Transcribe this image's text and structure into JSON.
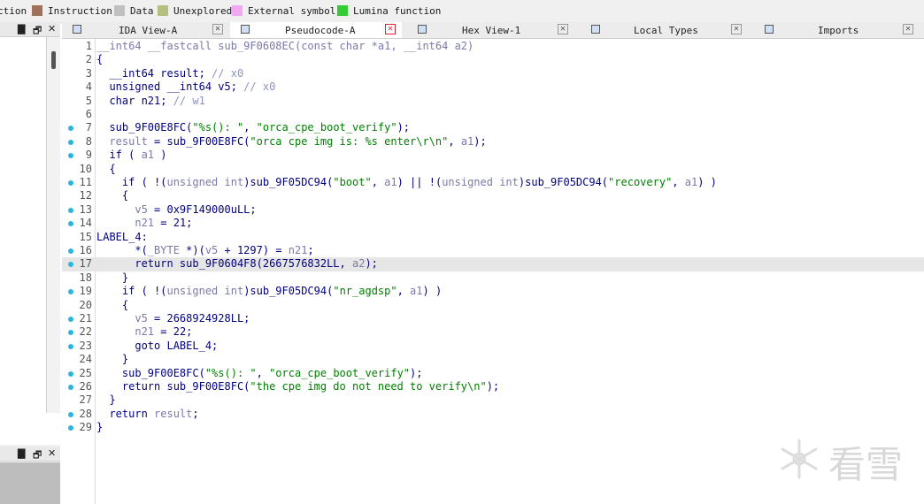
{
  "legend": [
    {
      "label": "ction",
      "color": null
    },
    {
      "label": "Instruction",
      "color": "#a0705a"
    },
    {
      "label": "Data",
      "color": "#c0c0c0"
    },
    {
      "label": "Unexplored",
      "color": "#b4c07e"
    },
    {
      "label": "External symbol",
      "color": "#f4a8f4"
    },
    {
      "label": "Lumina function",
      "color": "#33cc33"
    }
  ],
  "pane_controls": {
    "menu": "▇",
    "float": "🗗",
    "close": "✕"
  },
  "tabs": [
    {
      "label": "IDA View-A",
      "active": false
    },
    {
      "label": "Pseudocode-A",
      "active": true
    },
    {
      "label": "Hex View-1",
      "active": false
    },
    {
      "label": "Local Types",
      "active": false
    },
    {
      "label": "Imports",
      "active": false
    }
  ],
  "code_lines": [
    {
      "n": "1",
      "dot": false,
      "html": "<span class=\"gr\">__int64 __fastcall sub_9F0608EC(const char *a1, __int64 a2)</span>"
    },
    {
      "n": "2",
      "dot": false,
      "html": "{"
    },
    {
      "n": "3",
      "dot": false,
      "html": "  __int64 result; <span class=\"cm\">// x0</span>"
    },
    {
      "n": "4",
      "dot": false,
      "html": "  unsigned __int64 v5; <span class=\"cm\">// x0</span>"
    },
    {
      "n": "5",
      "dot": false,
      "html": "  char n21; <span class=\"cm\">// w1</span>"
    },
    {
      "n": "6",
      "dot": false,
      "html": ""
    },
    {
      "n": "7",
      "dot": true,
      "html": "  sub_9F00E8FC(<span class=\"str\">\"%s(): \"</span>, <span class=\"str\">\"orca_cpe_boot_verify\"</span>);"
    },
    {
      "n": "8",
      "dot": true,
      "html": "  <span class=\"gr\">result</span> = sub_9F00E8FC(<span class=\"str\">\"orca cpe img is: %s enter\\r\\n\"</span>, <span class=\"gr\">a1</span>);"
    },
    {
      "n": "9",
      "dot": true,
      "html": "  if ( <span class=\"gr\">a1</span> )"
    },
    {
      "n": "10",
      "dot": false,
      "html": "  {"
    },
    {
      "n": "11",
      "dot": true,
      "html": "    if ( !(<span class=\"gr\">unsigned int</span>)sub_9F05DC94(<span class=\"str\">\"boot\"</span>, <span class=\"gr\">a1</span>) || !(<span class=\"gr\">unsigned int</span>)sub_9F05DC94(<span class=\"str\">\"recovery\"</span>, <span class=\"gr\">a1</span>) )"
    },
    {
      "n": "12",
      "dot": false,
      "html": "    {"
    },
    {
      "n": "13",
      "dot": true,
      "html": "      <span class=\"gr\">v5</span> = 0x9F149000uLL;"
    },
    {
      "n": "14",
      "dot": true,
      "html": "      <span class=\"gr\">n21</span> = 21;"
    },
    {
      "n": "15",
      "dot": false,
      "html": "LABEL_4:"
    },
    {
      "n": "16",
      "dot": true,
      "html": "      *(<span class=\"gr\">_BYTE</span> *)(<span class=\"gr\">v5</span> + 1297) = <span class=\"gr\">n21</span>;"
    },
    {
      "n": "17",
      "dot": true,
      "html": "      return sub_9F0604F8(2667576832LL, <span class=\"gr\">a2</span>);",
      "highlight": true
    },
    {
      "n": "18",
      "dot": false,
      "html": "    }"
    },
    {
      "n": "19",
      "dot": true,
      "html": "    if ( !(<span class=\"gr\">unsigned int</span>)sub_9F05DC94(<span class=\"str\">\"nr_agdsp\"</span>, <span class=\"gr\">a1</span>) )"
    },
    {
      "n": "20",
      "dot": false,
      "html": "    {"
    },
    {
      "n": "21",
      "dot": true,
      "html": "      <span class=\"gr\">v5</span> = 2668924928LL;"
    },
    {
      "n": "22",
      "dot": true,
      "html": "      <span class=\"gr\">n21</span> = 22;"
    },
    {
      "n": "23",
      "dot": true,
      "html": "      goto LABEL_4;"
    },
    {
      "n": "24",
      "dot": false,
      "html": "    }"
    },
    {
      "n": "25",
      "dot": true,
      "html": "    sub_9F00E8FC(<span class=\"str\">\"%s(): \"</span>, <span class=\"str\">\"orca_cpe_boot_verify\"</span>);"
    },
    {
      "n": "26",
      "dot": true,
      "html": "    return sub_9F00E8FC(<span class=\"str\">\"the cpe img do not need to verify\\n\"</span>);"
    },
    {
      "n": "27",
      "dot": false,
      "html": "  }"
    },
    {
      "n": "28",
      "dot": true,
      "html": "  return <span class=\"gr\">result</span>;"
    },
    {
      "n": "29",
      "dot": true,
      "html": "}"
    }
  ],
  "watermark": "看雪"
}
